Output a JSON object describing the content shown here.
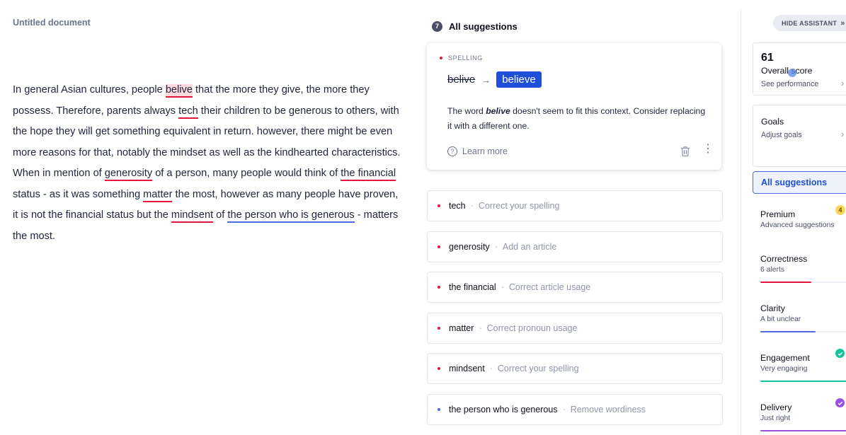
{
  "document": {
    "title": "Untitled document",
    "segments": [
      {
        "text": "In general Asian cultures, people "
      },
      {
        "text": "belive",
        "style": "red-hl"
      },
      {
        "text": " that the more they give, the more they possess. Therefore, parents always "
      },
      {
        "text": "tech",
        "style": "red"
      },
      {
        "text": " their children to be generous to others, with the hope they will get something equivalent in return. however, there might be even more reasons for that, notably the mindset as well as the kindhearted characteristics. When in mention of "
      },
      {
        "text": "generosity",
        "style": "red"
      },
      {
        "text": " of a person, many people would think of "
      },
      {
        "text": "the financial",
        "style": "red"
      },
      {
        "text": " status - as it was something "
      },
      {
        "text": "matter",
        "style": "red"
      },
      {
        "text": " the most, however as many people have proven, it is not the financial status but the "
      },
      {
        "text": "mindsent",
        "style": "red"
      },
      {
        "text": " of "
      },
      {
        "text": "the person who is generous",
        "style": "blue"
      },
      {
        "text": " - matters the most."
      }
    ]
  },
  "suggestions_panel": {
    "count": "7",
    "title": "All suggestions",
    "active_card": {
      "category": "SPELLING",
      "original": "belive",
      "replacement": "believe",
      "desc_prefix": "The word ",
      "desc_word": "belive",
      "desc_suffix": " doesn't seem to fit this context. Consider replacing it with a different one.",
      "learn_more": "Learn more"
    },
    "items": [
      {
        "term": "tech",
        "hint": "Correct your spelling",
        "color": "#e5163c"
      },
      {
        "term": "generosity",
        "hint": "Add an article",
        "color": "#e5163c"
      },
      {
        "term": "the financial",
        "hint": "Correct article usage",
        "color": "#e5163c"
      },
      {
        "term": "matter",
        "hint": "Correct pronoun usage",
        "color": "#e5163c"
      },
      {
        "term": "mindsent",
        "hint": "Correct your spelling",
        "color": "#e5163c"
      },
      {
        "term": "the person who is generous",
        "hint": "Remove wordiness",
        "color": "#4d6ae0"
      }
    ]
  },
  "assistant": {
    "hide_label": "HIDE ASSISTANT",
    "hide_chevron": "»",
    "score": "61",
    "score_label": "Overall score",
    "score_sub": "See performance",
    "goals_label": "Goals",
    "goals_sub": "Adjust goals",
    "all_suggestions": "All suggestions",
    "premium": {
      "title": "Premium",
      "sub": "Advanced suggestions",
      "badge": "4"
    },
    "categories": [
      {
        "title": "Correctness",
        "sub": "6 alerts",
        "color": "#e5163c",
        "level": 0.55
      },
      {
        "title": "Clarity",
        "sub": "A bit unclear",
        "color": "#4d6ae0",
        "level": 0.6
      },
      {
        "title": "Engagement",
        "sub": "Very engaging",
        "color": "#15c39a",
        "level": 1.0
      },
      {
        "title": "Delivery",
        "sub": "Just right",
        "color": "#9b51e0",
        "level": 1.0
      }
    ]
  }
}
